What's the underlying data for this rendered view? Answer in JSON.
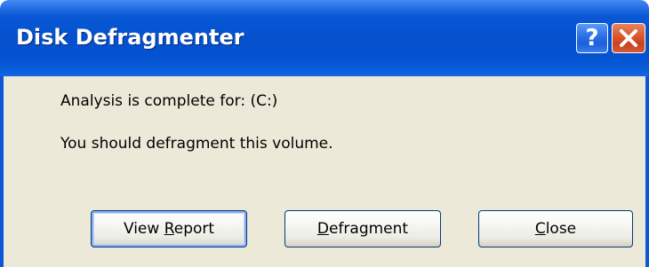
{
  "window": {
    "title": "Disk Defragmenter"
  },
  "titlebar": {
    "help_label": "?",
    "help_icon": "help-icon",
    "close_icon": "close-icon"
  },
  "dialog": {
    "status_message": "Analysis is complete for: (C:)",
    "recommendation": "You should defragment this volume."
  },
  "buttons": {
    "view_report": {
      "prefix": "View ",
      "mnemonic": "R",
      "suffix": "eport"
    },
    "defragment": {
      "prefix": "",
      "mnemonic": "D",
      "suffix": "efragment"
    },
    "close": {
      "prefix": "",
      "mnemonic": "C",
      "suffix": "lose"
    }
  },
  "colors": {
    "titlebar": "#0453d0",
    "dialog_background": "#ece9d8",
    "close_button": "#c9411e"
  }
}
